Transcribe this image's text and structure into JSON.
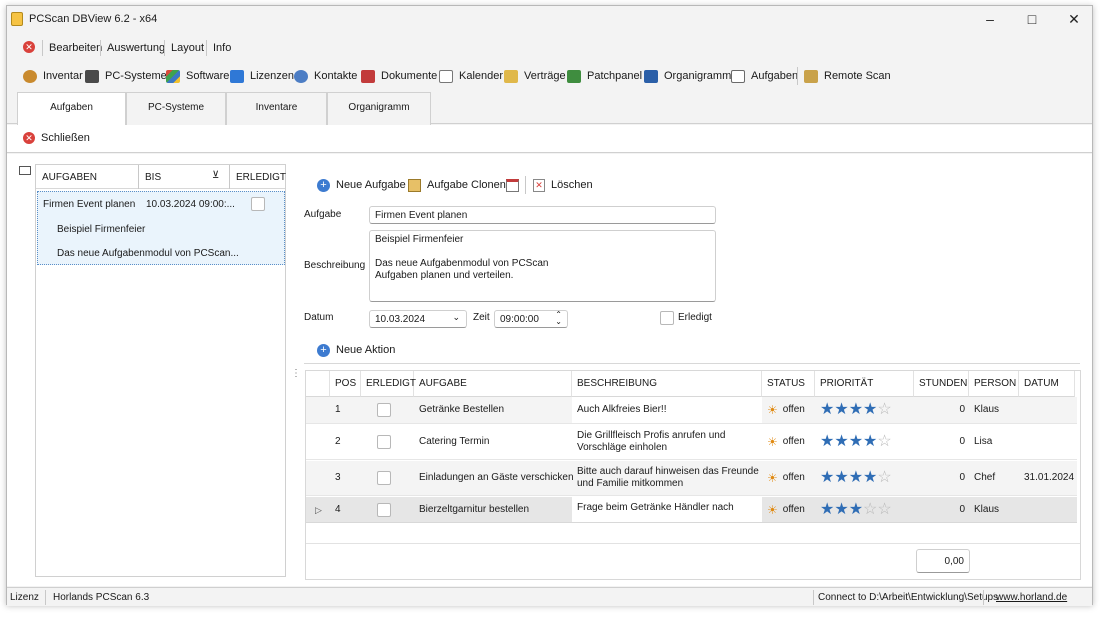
{
  "window": {
    "title": "PCScan DBView 6.2 - x64"
  },
  "menu": [
    "Bearbeiten",
    "Auswertung",
    "Layout",
    "Info"
  ],
  "toolbar": [
    {
      "label": "Inventar",
      "icon": "inventory-icon",
      "color": "#c98a2e"
    },
    {
      "label": "PC-Systeme",
      "icon": "pc-icon",
      "color": "#4a4a4a"
    },
    {
      "label": "Software",
      "icon": "software-icon",
      "color": "#3b78c3"
    },
    {
      "label": "Lizenzen",
      "icon": "license-icon",
      "color": "#2f78d6"
    },
    {
      "label": "Kontakte",
      "icon": "contacts-icon",
      "color": "#4c7dc4"
    },
    {
      "label": "Dokumente",
      "icon": "documents-icon",
      "color": "#c23b3b"
    },
    {
      "label": "Kalender",
      "icon": "calendar-icon",
      "color": "#8a8a8a"
    },
    {
      "label": "Verträge",
      "icon": "contracts-icon",
      "color": "#e0b84a"
    },
    {
      "label": "Patchpanel",
      "icon": "patchpanel-icon",
      "color": "#3f8d3f"
    },
    {
      "label": "Organigramm",
      "icon": "orgchart-icon",
      "color": "#2b5fa8"
    },
    {
      "label": "Aufgaben",
      "icon": "tasks-icon",
      "color": "#6a6a6a"
    },
    {
      "label": "Remote Scan",
      "icon": "remote-scan-icon",
      "color": "#c9a24a"
    }
  ],
  "tabs": [
    "Aufgaben",
    "PC-Systeme",
    "Inventare",
    "Organigramm"
  ],
  "close_label": "Schließen",
  "task_list": {
    "headers": [
      "AUFGABEN",
      "BIS",
      "ERLEDIGT"
    ],
    "selected": {
      "title": "Firmen Event planen",
      "due": "10.03.2024 09:00:...",
      "line1": "Beispiel Firmenfeier",
      "line2": "Das neue Aufgabenmodul von PCScan..."
    }
  },
  "actions": {
    "new": "Neue Aufgabe",
    "clone": "Aufgabe Clonen",
    "delete": "Löschen"
  },
  "form": {
    "task_label": "Aufgabe",
    "task_value": "Firmen Event planen",
    "desc_label": "Beschreibung",
    "desc_line1": "Beispiel Firmenfeier",
    "desc_line2": "Das neue Aufgabenmodul von PCScan",
    "desc_line3": "Aufgaben planen und verteilen.",
    "date_label": "Datum",
    "date_value": "10.03.2024",
    "time_label": "Zeit",
    "time_value": "09:00:00",
    "done_label": "Erledigt"
  },
  "new_action": "Neue Aktion",
  "grid": {
    "headers": [
      "POS",
      "ERLEDIGT",
      "AUFGABE",
      "BESCHREIBUNG",
      "STATUS",
      "PRIORITÄT",
      "STUNDEN",
      "PERSON",
      "DATUM"
    ],
    "rows": [
      {
        "pos": "1",
        "task": "Getränke Bestellen",
        "desc1": "Auch Alkfreies Bier!!",
        "desc2": "",
        "status": "offen",
        "priority": 4,
        "hours": "0",
        "person": "Klaus",
        "date": ""
      },
      {
        "pos": "2",
        "task": "Catering Termin",
        "desc1": "Die Grillfleisch Profis anrufen und",
        "desc2": "Vorschläge einholen",
        "status": "offen",
        "priority": 4,
        "hours": "0",
        "person": "Lisa",
        "date": ""
      },
      {
        "pos": "3",
        "task": "Einladungen an Gäste verschicken",
        "desc1": "Bitte auch darauf hinweisen das Freunde",
        "desc2": "und Familie mitkommen",
        "status": "offen",
        "priority": 4,
        "hours": "0",
        "person": "Chef",
        "date": "31.01.2024"
      },
      {
        "pos": "4",
        "task": "Bierzeltgarnitur bestellen",
        "desc1": "Frage beim Getränke Händler nach",
        "desc2": "",
        "status": "offen",
        "priority": 3,
        "hours": "0",
        "person": "Klaus",
        "date": ""
      }
    ],
    "total": "0,00"
  },
  "statusbar": {
    "license": "Lizenz",
    "product": "Horlands PCScan 6.3",
    "connection": "Connect to D:\\Arbeit\\Entwicklung\\Setups",
    "website": "www.horland.de"
  }
}
